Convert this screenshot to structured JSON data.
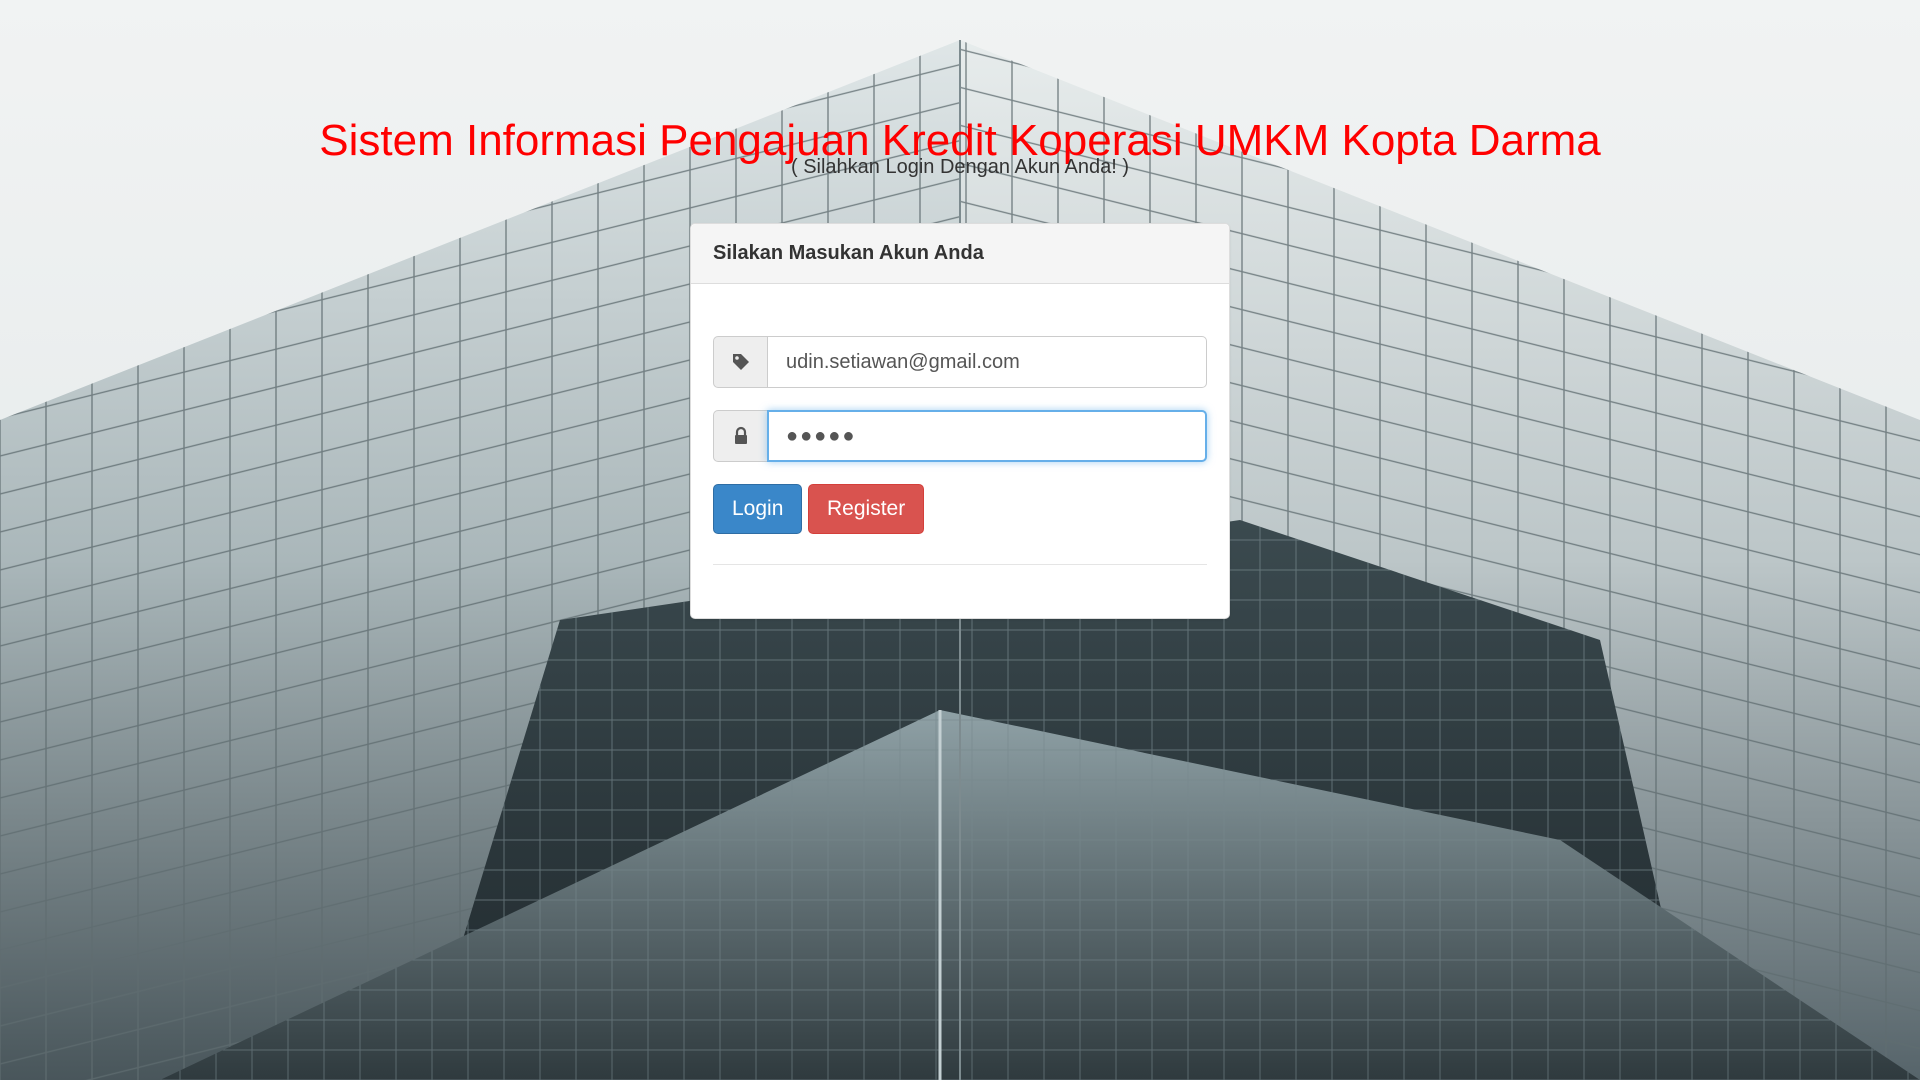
{
  "header": {
    "title": "Sistem Informasi Pengajuan Kredit Koperasi UMKM Kopta Darma",
    "subtitle": "( Silahkan Login Dengan Akun Anda! )"
  },
  "login_panel": {
    "heading": "Silakan Masukan Akun Anda",
    "email": {
      "icon": "tag-icon",
      "value": "udin.setiawan@gmail.com"
    },
    "password": {
      "icon": "lock-icon",
      "value": "●●●●●"
    },
    "login_label": "Login",
    "register_label": "Register"
  },
  "colors": {
    "title": "#ff0000",
    "login_button": "#3a87c9",
    "register_button": "#d9534f",
    "focus_ring": "#66afe9"
  }
}
